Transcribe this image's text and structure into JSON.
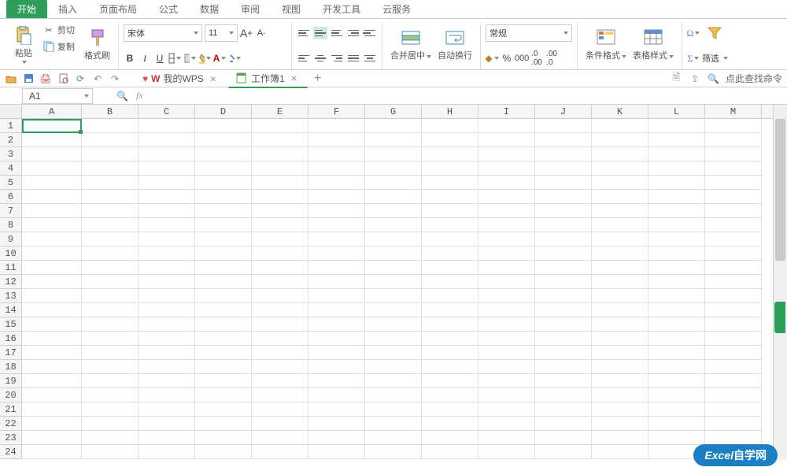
{
  "menu": {
    "tabs": [
      "开始",
      "插入",
      "页面布局",
      "公式",
      "数据",
      "审阅",
      "视图",
      "开发工具",
      "云服务"
    ],
    "active": 0
  },
  "ribbon": {
    "clipboard": {
      "paste": "粘贴",
      "cut": "剪切",
      "copy": "复制",
      "format_painter": "格式刷"
    },
    "font": {
      "name": "宋体",
      "size": "11",
      "bold": "B",
      "italic": "I",
      "underline": "U"
    },
    "merge": "合并居中",
    "wrap": "自动换行",
    "number_format": "常规",
    "cond_format": "条件格式",
    "table_style": "表格样式",
    "filter": "筛选"
  },
  "qat": {
    "wps_tab": "我的WPS",
    "workbook_tab": "工作簿1",
    "search_cmd": "点此查找命令"
  },
  "name_box": "A1",
  "columns": [
    "A",
    "B",
    "C",
    "D",
    "E",
    "F",
    "G",
    "H",
    "I",
    "J",
    "K",
    "L",
    "M"
  ],
  "rows": [
    "1",
    "2",
    "3",
    "4",
    "5",
    "6",
    "7",
    "8",
    "9",
    "10",
    "11",
    "12",
    "13",
    "14",
    "15",
    "16",
    "17",
    "18",
    "19",
    "20",
    "21",
    "22",
    "23",
    "24"
  ],
  "watermark": {
    "bold": "Excel",
    "rest": "自学网"
  }
}
